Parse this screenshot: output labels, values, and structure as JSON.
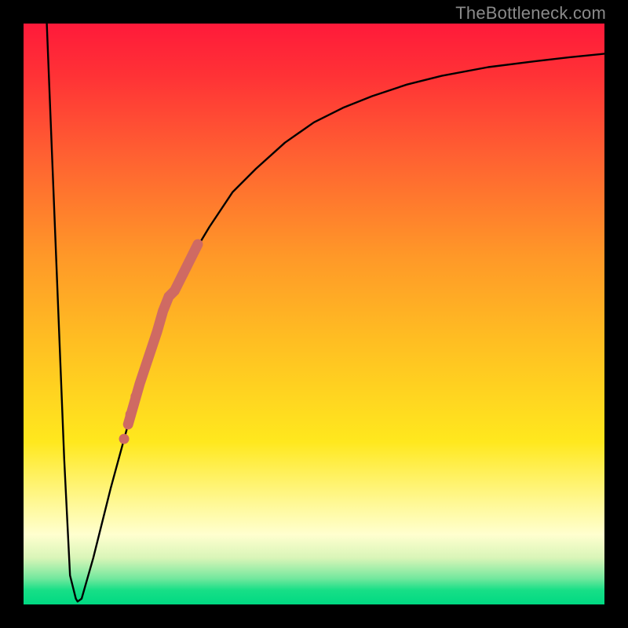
{
  "watermark": {
    "text": "TheBottleneck.com"
  },
  "chart_data": {
    "type": "line",
    "title": "",
    "xlabel": "",
    "ylabel": "",
    "xlim": [
      0,
      100
    ],
    "ylim": [
      0,
      100
    ],
    "grid": false,
    "series": [
      {
        "name": "curve",
        "x": [
          4,
          5,
          6,
          7,
          8,
          9,
          9.3,
          10,
          12,
          15,
          18,
          20,
          23,
          26,
          29,
          32,
          36,
          40,
          45,
          50,
          55,
          60,
          66,
          72,
          80,
          88,
          94,
          100
        ],
        "y": [
          100,
          75,
          50,
          25,
          5,
          1,
          0.5,
          1,
          8,
          20,
          31,
          38,
          47,
          54,
          60,
          65,
          71,
          75,
          79.5,
          83,
          85.5,
          87.5,
          89.5,
          91,
          92.5,
          93.5,
          94.2,
          94.8
        ]
      },
      {
        "name": "highlighted-segment",
        "x": [
          18,
          19,
          20,
          21,
          22,
          23,
          24,
          25,
          26,
          27,
          28,
          29,
          30
        ],
        "y": [
          31,
          34.5,
          38,
          41,
          44,
          47,
          50.5,
          53,
          54,
          56,
          58,
          60,
          62
        ]
      }
    ],
    "markers": [
      {
        "x": 17.3,
        "y": 28.5
      },
      {
        "x": 18.4,
        "y": 32.7
      },
      {
        "x": 19.3,
        "y": 35.8
      }
    ],
    "colors": {
      "curve": "#000000",
      "highlight": "#cf6a63",
      "marker": "#cf6a63"
    }
  }
}
